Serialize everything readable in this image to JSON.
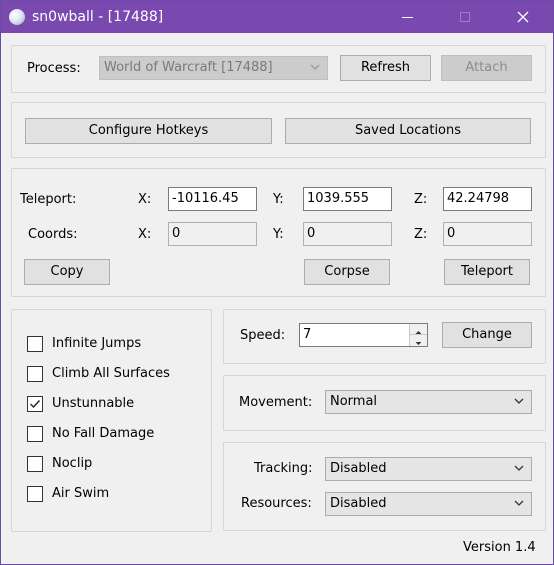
{
  "window": {
    "title": "sn0wball - [17488]"
  },
  "process": {
    "label": "Process:",
    "selected": "World of Warcraft [17488]",
    "refresh_label": "Refresh",
    "attach_label": "Attach"
  },
  "toolbar": {
    "configure_hotkeys_label": "Configure Hotkeys",
    "saved_locations_label": "Saved Locations"
  },
  "teleport": {
    "label": "Teleport:",
    "x_label": "X:",
    "y_label": "Y:",
    "z_label": "Z:",
    "x_value": "-10116.45",
    "y_value": "1039.555",
    "z_value": "42.24798"
  },
  "coords": {
    "label": "Coords:",
    "x_label": "X:",
    "y_label": "Y:",
    "z_label": "Z:",
    "x_value": "0",
    "y_value": "0",
    "z_value": "0"
  },
  "actions": {
    "copy_label": "Copy",
    "corpse_label": "Corpse",
    "teleport_label": "Teleport"
  },
  "options": [
    {
      "label": "Infinite Jumps",
      "checked": false
    },
    {
      "label": "Climb All Surfaces",
      "checked": false
    },
    {
      "label": "Unstunnable",
      "checked": true
    },
    {
      "label": "No Fall Damage",
      "checked": false
    },
    {
      "label": "Noclip",
      "checked": false
    },
    {
      "label": "Air Swim",
      "checked": false
    }
  ],
  "speed": {
    "label": "Speed:",
    "value": "7",
    "change_label": "Change"
  },
  "movement": {
    "label": "Movement:",
    "selected": "Normal"
  },
  "tracking": {
    "label": "Tracking:",
    "selected": "Disabled"
  },
  "resources": {
    "label": "Resources:",
    "selected": "Disabled"
  },
  "footer": {
    "version": "Version 1.4"
  },
  "colors": {
    "titlebar": "#7a49b0",
    "window_bg": "#f0f0f0",
    "button_bg": "#e1e1e1"
  }
}
